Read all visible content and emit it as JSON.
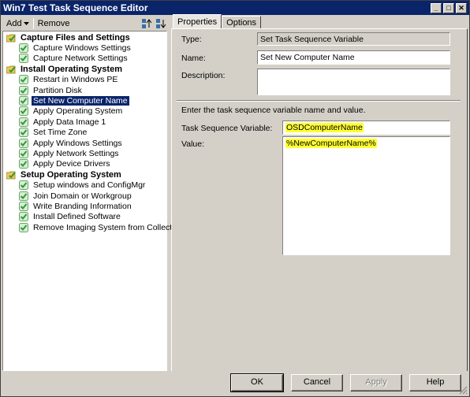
{
  "window": {
    "title": "Win7 Test Task Sequence Editor",
    "controls": [
      "_",
      "□",
      "✕"
    ]
  },
  "toolbar": {
    "add_label": "Add",
    "remove_label": "Remove"
  },
  "tree": [
    {
      "kind": "group",
      "label": "Capture Files and Settings",
      "icon": "folder-check-icon"
    },
    {
      "kind": "step",
      "label": "Capture Windows Settings",
      "icon": "green-check-icon"
    },
    {
      "kind": "step",
      "label": "Capture Network Settings",
      "icon": "green-check-icon"
    },
    {
      "kind": "group",
      "label": "Install Operating System",
      "icon": "folder-check-icon"
    },
    {
      "kind": "step",
      "label": "Restart in Windows PE",
      "icon": "green-check-icon"
    },
    {
      "kind": "step",
      "label": "Partition Disk",
      "icon": "green-check-icon"
    },
    {
      "kind": "step",
      "label": "Set New Computer Name",
      "icon": "green-check-icon",
      "selected": true
    },
    {
      "kind": "step",
      "label": "Apply Operating System",
      "icon": "green-check-icon"
    },
    {
      "kind": "step",
      "label": "Apply Data Image 1",
      "icon": "green-check-icon"
    },
    {
      "kind": "step",
      "label": "Set Time Zone",
      "icon": "green-check-icon"
    },
    {
      "kind": "step",
      "label": "Apply Windows Settings",
      "icon": "green-check-icon"
    },
    {
      "kind": "step",
      "label": "Apply Network Settings",
      "icon": "green-check-icon"
    },
    {
      "kind": "step",
      "label": "Apply Device Drivers",
      "icon": "green-check-icon"
    },
    {
      "kind": "group",
      "label": "Setup Operating System",
      "icon": "folder-check-icon"
    },
    {
      "kind": "step",
      "label": "Setup windows and ConfigMgr",
      "icon": "green-check-icon"
    },
    {
      "kind": "step",
      "label": "Join Domain or Workgroup",
      "icon": "green-check-icon"
    },
    {
      "kind": "step",
      "label": "Write Branding Information",
      "icon": "green-check-icon"
    },
    {
      "kind": "step",
      "label": "Install Defined Software",
      "icon": "green-check-icon"
    },
    {
      "kind": "step",
      "label": "Remove Imaging System from Collection",
      "icon": "green-check-icon"
    }
  ],
  "tabs": [
    {
      "label": "Properties",
      "active": true
    },
    {
      "label": "Options",
      "active": false
    }
  ],
  "properties": {
    "type_label": "Type:",
    "type_value": "Set Task Sequence Variable",
    "name_label": "Name:",
    "name_value": "Set New Computer Name",
    "description_label": "Description:",
    "description_value": "",
    "instructions": "Enter the task sequence variable name and value.",
    "variable_label": "Task Sequence Variable:",
    "variable_value": "OSDComputerName",
    "value_label": "Value:",
    "value_value": "%NewComputerName%"
  },
  "buttons": {
    "ok": "OK",
    "cancel": "Cancel",
    "apply": "Apply",
    "help": "Help"
  },
  "colors": {
    "selection": "#0a246a",
    "highlight": "#ffff33",
    "check": "#2e9e2e"
  }
}
